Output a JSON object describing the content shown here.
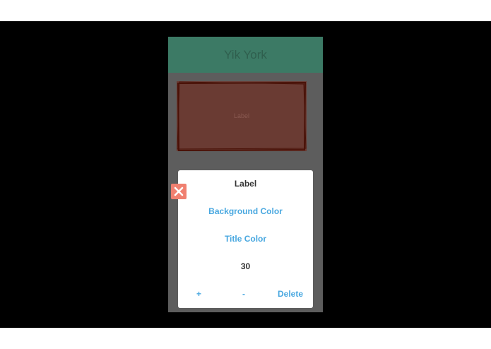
{
  "app": {
    "title": "Yik York"
  },
  "canvas": {
    "label_text": "Label"
  },
  "editor": {
    "title": "Label",
    "background_color_label": "Background Color",
    "title_color_label": "Title Color",
    "font_size": "30",
    "increase_label": "+",
    "decrease_label": "-",
    "delete_label": "Delete"
  },
  "colors": {
    "nav_bar": "#3c7a65",
    "accent": "#49a8e0",
    "label_fill": "#6a3b33",
    "label_border": "#4a1208",
    "close_button": "#f08070"
  },
  "icons": {
    "close": "close-icon"
  }
}
